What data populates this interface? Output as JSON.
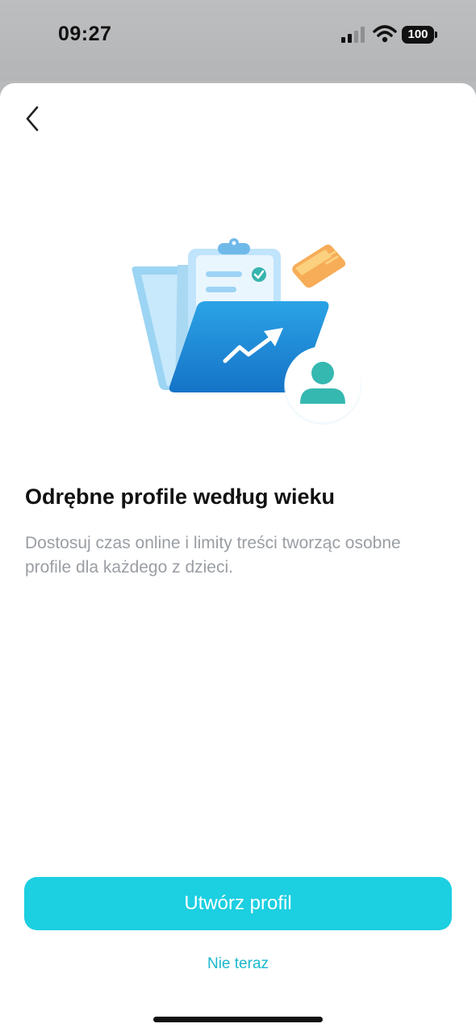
{
  "status_bar": {
    "time": "09:27",
    "battery": "100",
    "icons": [
      "signal-icon",
      "wifi-icon",
      "battery-icon"
    ]
  },
  "nav": {
    "back_icon": "chevron-left-icon"
  },
  "illustration": {
    "icons": [
      "folder-icon",
      "clipboard-icon",
      "check-icon",
      "trend-arrow-icon",
      "card-icon",
      "user-avatar-icon"
    ]
  },
  "content": {
    "title": "Odrębne profile według wieku",
    "description": "Dostosuj czas online i limity treści tworząc osobne profile dla każdego z dzieci."
  },
  "actions": {
    "primary_label": "Utwórz profil",
    "secondary_label": "Nie teraz"
  },
  "colors": {
    "accent": "#1ccfe1",
    "link": "#1ab8cc",
    "folder_blue": "#1e88d6",
    "avatar_teal": "#35b8b0"
  }
}
